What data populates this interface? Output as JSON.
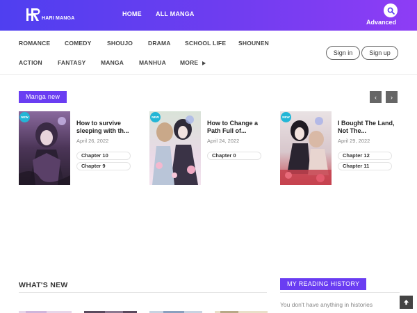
{
  "header": {
    "logo_text": "HARI MANGA",
    "nav": [
      {
        "label": "HOME"
      },
      {
        "label": "ALL MANGA"
      }
    ],
    "advanced_label": "Advanced"
  },
  "genres": {
    "row1": [
      "ROMANCE",
      "COMEDY",
      "SHOUJO",
      "DRAMA",
      "SCHOOL LIFE",
      "SHOUNEN"
    ],
    "row2": [
      "ACTION",
      "FANTASY",
      "MANGA",
      "MANHUA"
    ],
    "more_label": "MORE"
  },
  "auth": {
    "signin_label": "Sign in",
    "signup_label": "Sign up"
  },
  "manga_new": {
    "heading": "Manga new",
    "badge_label": "NEW",
    "items": [
      {
        "title": "How to survive sleeping with th...",
        "date": "April 26, 2022",
        "chapters": [
          "Chapter 10",
          "Chapter 9"
        ]
      },
      {
        "title": "How to Change a Path Full of...",
        "date": "April 24, 2022",
        "chapters": [
          "Chapter 0"
        ]
      },
      {
        "title": "I Bought The Land, Not The...",
        "date": "April 29, 2022",
        "chapters": [
          "Chapter 12",
          "Chapter 11"
        ]
      }
    ]
  },
  "whats_new": {
    "heading": "WHAT'S NEW"
  },
  "reading_history": {
    "heading": "MY READING HISTORY",
    "empty_text": "You don't have anything in histories"
  },
  "colors": {
    "header_start": "#4f3ff0",
    "header_end": "#8e3df5",
    "accent": "#6a3df2",
    "badge": "#23b6d6"
  }
}
